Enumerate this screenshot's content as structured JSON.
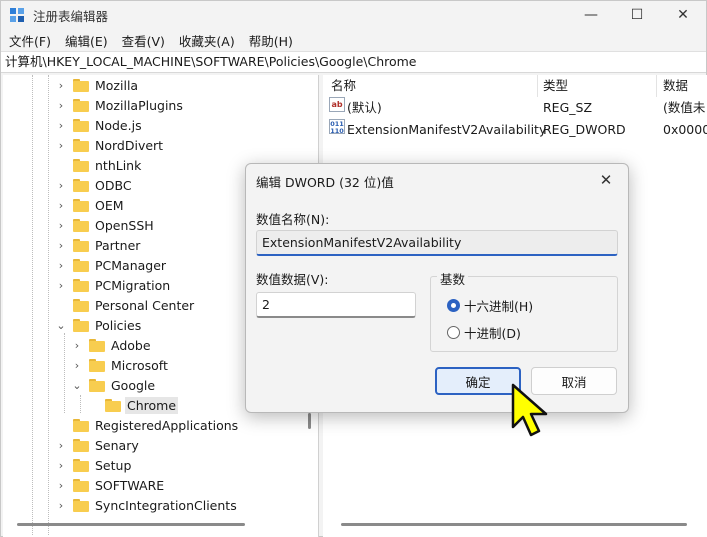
{
  "window": {
    "title": "注册表编辑器",
    "minimize": "—",
    "maximize": "☐",
    "close": "✕"
  },
  "menu": [
    "文件(F)",
    "编辑(E)",
    "查看(V)",
    "收藏夹(A)",
    "帮助(H)"
  ],
  "address": "计算机\\HKEY_LOCAL_MACHINE\\SOFTWARE\\Policies\\Google\\Chrome",
  "tree": [
    {
      "label": "Mozilla",
      "level": 0,
      "expander": "›"
    },
    {
      "label": "MozillaPlugins",
      "level": 0,
      "expander": "›"
    },
    {
      "label": "Node.js",
      "level": 0,
      "expander": "›"
    },
    {
      "label": "NordDivert",
      "level": 0,
      "expander": "›"
    },
    {
      "label": "nthLink",
      "level": 0,
      "expander": ""
    },
    {
      "label": "ODBC",
      "level": 0,
      "expander": "›"
    },
    {
      "label": "OEM",
      "level": 0,
      "expander": "›"
    },
    {
      "label": "OpenSSH",
      "level": 0,
      "expander": "›"
    },
    {
      "label": "Partner",
      "level": 0,
      "expander": "›"
    },
    {
      "label": "PCManager",
      "level": 0,
      "expander": "›"
    },
    {
      "label": "PCMigration",
      "level": 0,
      "expander": "›"
    },
    {
      "label": "Personal Center",
      "level": 0,
      "expander": ""
    },
    {
      "label": "Policies",
      "level": 0,
      "expander": "⌄"
    },
    {
      "label": "Adobe",
      "level": 1,
      "expander": "›"
    },
    {
      "label": "Microsoft",
      "level": 1,
      "expander": "›"
    },
    {
      "label": "Google",
      "level": 1,
      "expander": "⌄"
    },
    {
      "label": "Chrome",
      "level": 2,
      "expander": "",
      "selected": true
    },
    {
      "label": "RegisteredApplications",
      "level": 0,
      "expander": ""
    },
    {
      "label": "Senary",
      "level": 0,
      "expander": "›"
    },
    {
      "label": "Setup",
      "level": 0,
      "expander": "›"
    },
    {
      "label": "SOFTWARE",
      "level": 0,
      "expander": "›"
    },
    {
      "label": "SyncIntegrationClients",
      "level": 0,
      "expander": "›"
    }
  ],
  "list": {
    "columns": [
      "名称",
      "类型",
      "数据"
    ],
    "rows": [
      {
        "icon": "ab",
        "name": "(默认)",
        "type": "REG_SZ",
        "data": "(数值未"
      },
      {
        "icon": "bin",
        "name": "ExtensionManifestV2Availability",
        "type": "REG_DWORD",
        "data": "0x0000"
      }
    ]
  },
  "dialog": {
    "title": "编辑 DWORD (32 位)值",
    "close": "✕",
    "name_label": "数值名称(N):",
    "name_value": "ExtensionManifestV2Availability",
    "data_label": "数值数据(V):",
    "data_value": "2",
    "base_label": "基数",
    "hex_label": "十六进制(H)",
    "dec_label": "十进制(D)",
    "ok": "确定",
    "cancel": "取消"
  },
  "colors": {
    "accent": "#2c62c2",
    "folder": "#f8cd4f",
    "cursor": "#ffff00"
  }
}
